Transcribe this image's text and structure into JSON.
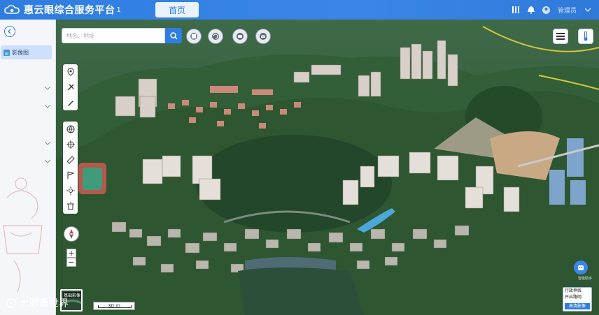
{
  "header": {
    "title": "惠云眼综合服务平台",
    "title_mark": "1",
    "home_tab": "首页",
    "user": "管理员",
    "brand_color": "#2f7de1"
  },
  "sidebar": {
    "active_layer": "影像图"
  },
  "search": {
    "placeholder": "地名、地址"
  },
  "map": {
    "scale": "30 m",
    "thumbnail_label": "基础影像",
    "zoom_in": "+",
    "zoom_out": "−",
    "panel": {
      "row1": "行政界线",
      "row2": "开启路网",
      "button": "高清影像"
    },
    "float_label": "智能助手"
  },
  "watermark": {
    "text": "大眼看世界"
  }
}
